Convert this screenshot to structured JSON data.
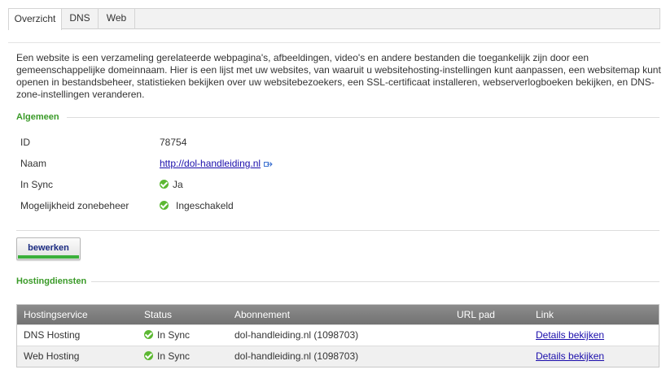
{
  "tabs": [
    {
      "label": "Overzicht",
      "active": true
    },
    {
      "label": "DNS",
      "active": false
    },
    {
      "label": "Web",
      "active": false
    }
  ],
  "intro": "Een website is een verzameling gerelateerde webpagina's, afbeeldingen, video's en andere bestanden die toegankelijk zijn door een\ngemeenschappelijke domeinnaam. Hier is een lijst met uw websites, van waaruit u websitehosting-instellingen kunt aanpassen, een websitemap kunt\nopenen in bestandsbeheer, statistieken bekijken over uw websitebezoekers, een SSL-certificaat installeren, webserverlogboeken bekijken, en DNS-\nzone-instellingen veranderen.",
  "general": {
    "title": "Algemeen",
    "rows": [
      {
        "label": "ID",
        "value": "78754"
      },
      {
        "label": "Naam",
        "value": "http://dol-handleiding.nl"
      },
      {
        "label": "In Sync",
        "value": "Ja"
      },
      {
        "label": "Mogelijkheid zonebeheer",
        "value": "Ingeschakeld"
      }
    ]
  },
  "edit_button": "bewerken",
  "hosting": {
    "title": "Hostingdiensten",
    "columns": [
      "Hostingservice",
      "Status",
      "Abonnement",
      "URL pad",
      "Link"
    ],
    "rows": [
      {
        "service": "DNS Hosting",
        "status": "In Sync",
        "subscription": "dol-handleiding.nl (1098703)",
        "url_path": "",
        "link": "Details bekijken"
      },
      {
        "service": "Web Hosting",
        "status": "In Sync",
        "subscription": "dol-handleiding.nl (1098703)",
        "url_path": "",
        "link": "Details bekijken"
      }
    ]
  },
  "colors": {
    "accent_green": "#3a9a28",
    "status_green": "#5cb832",
    "link_blue": "#1a0dab",
    "header_gray": "#7f7f7f"
  },
  "icons": {
    "external_link": "external-link-icon",
    "status_ok": "check-circle-icon"
  }
}
